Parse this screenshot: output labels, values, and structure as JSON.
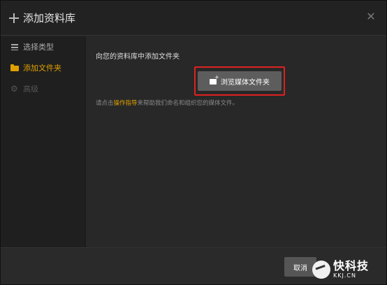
{
  "dialog": {
    "title": "添加资料库"
  },
  "sidebar": {
    "items": [
      {
        "label": "选择类型",
        "icon": "lines-icon",
        "state": "normal"
      },
      {
        "label": "添加文件夹",
        "icon": "folder-icon",
        "state": "active"
      },
      {
        "label": "高级",
        "icon": "cog-icon",
        "state": "disabled"
      }
    ]
  },
  "main": {
    "heading": "向您的资料库中添加文件夹",
    "browse_label": "浏览媒体文件夹",
    "help_prefix": "请点击",
    "help_link": "操作指导",
    "help_suffix": "来帮助我们命名和组织您的媒体文件。"
  },
  "footer": {
    "cancel_label": "取消"
  },
  "watermark": {
    "cn": "快科技",
    "en": "KKJ.CN"
  },
  "colors": {
    "accent": "#e0a000",
    "highlight_border": "#e02020",
    "background": "#282828"
  }
}
